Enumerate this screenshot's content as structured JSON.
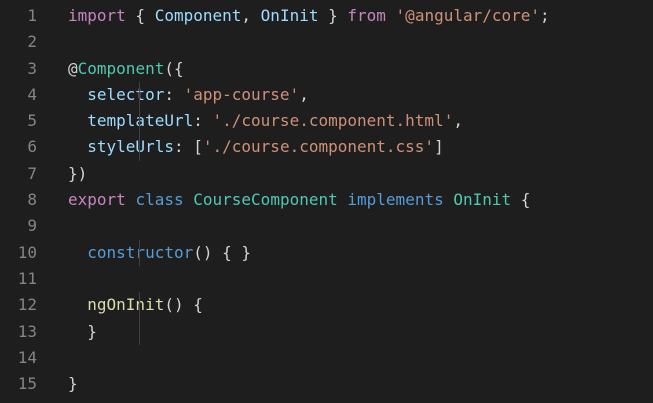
{
  "editor": {
    "background": "#1e1e1e",
    "theme_colors": {
      "keyword_control": "#c586c0",
      "keyword": "#569cd6",
      "type": "#4ec9b0",
      "string": "#ce9178",
      "property": "#9cdcfe",
      "function": "#dcdcaa",
      "punctuation": "#d4d4d4",
      "line_number": "#858585"
    },
    "lines": [
      {
        "number": "1",
        "tokens": [
          {
            "t": "import",
            "c": "kw"
          },
          {
            "t": " { ",
            "c": "p"
          },
          {
            "t": "Component",
            "c": "prop"
          },
          {
            "t": ", ",
            "c": "p"
          },
          {
            "t": "OnInit",
            "c": "prop"
          },
          {
            "t": " } ",
            "c": "p"
          },
          {
            "t": "from",
            "c": "kw"
          },
          {
            "t": " ",
            "c": "p"
          },
          {
            "t": "'@angular/core'",
            "c": "str"
          },
          {
            "t": ";",
            "c": "p"
          }
        ]
      },
      {
        "number": "2",
        "tokens": []
      },
      {
        "number": "3",
        "tokens": [
          {
            "t": "@",
            "c": "p"
          },
          {
            "t": "Component",
            "c": "cls"
          },
          {
            "t": "({",
            "c": "p"
          }
        ]
      },
      {
        "number": "4",
        "guide": true,
        "tokens": [
          {
            "t": "  ",
            "c": "p"
          },
          {
            "t": "selector",
            "c": "prop"
          },
          {
            "t": ": ",
            "c": "p"
          },
          {
            "t": "'app-course'",
            "c": "str"
          },
          {
            "t": ",",
            "c": "p"
          }
        ]
      },
      {
        "number": "5",
        "guide": true,
        "tokens": [
          {
            "t": "  ",
            "c": "p"
          },
          {
            "t": "templateUrl",
            "c": "prop"
          },
          {
            "t": ": ",
            "c": "p"
          },
          {
            "t": "'./course.component.html'",
            "c": "str"
          },
          {
            "t": ",",
            "c": "p"
          }
        ]
      },
      {
        "number": "6",
        "guide": true,
        "tokens": [
          {
            "t": "  ",
            "c": "p"
          },
          {
            "t": "styleUrls",
            "c": "prop"
          },
          {
            "t": ": [",
            "c": "p"
          },
          {
            "t": "'./course.component.css'",
            "c": "str"
          },
          {
            "t": "]",
            "c": "p"
          }
        ]
      },
      {
        "number": "7",
        "tokens": [
          {
            "t": "})",
            "c": "p"
          }
        ]
      },
      {
        "number": "8",
        "tokens": [
          {
            "t": "export",
            "c": "kw"
          },
          {
            "t": " ",
            "c": "p"
          },
          {
            "t": "class",
            "c": "kw2"
          },
          {
            "t": " ",
            "c": "p"
          },
          {
            "t": "CourseComponent",
            "c": "cls"
          },
          {
            "t": " ",
            "c": "p"
          },
          {
            "t": "implements",
            "c": "kw2"
          },
          {
            "t": " ",
            "c": "p"
          },
          {
            "t": "OnInit",
            "c": "cls"
          },
          {
            "t": " {",
            "c": "p"
          }
        ]
      },
      {
        "number": "9",
        "guide": true,
        "tokens": []
      },
      {
        "number": "10",
        "guide": true,
        "tokens": [
          {
            "t": "  ",
            "c": "p"
          },
          {
            "t": "constructor",
            "c": "kw2"
          },
          {
            "t": "() { }",
            "c": "p"
          }
        ]
      },
      {
        "number": "11",
        "guide": true,
        "tokens": []
      },
      {
        "number": "12",
        "guide": true,
        "tokens": [
          {
            "t": "  ",
            "c": "p"
          },
          {
            "t": "ngOnInit",
            "c": "fn"
          },
          {
            "t": "() {",
            "c": "p"
          }
        ]
      },
      {
        "number": "13",
        "guide": true,
        "tokens": [
          {
            "t": "  }",
            "c": "p"
          }
        ]
      },
      {
        "number": "14",
        "guide": true,
        "tokens": []
      },
      {
        "number": "15",
        "tokens": [
          {
            "t": "}",
            "c": "p"
          }
        ]
      }
    ]
  }
}
